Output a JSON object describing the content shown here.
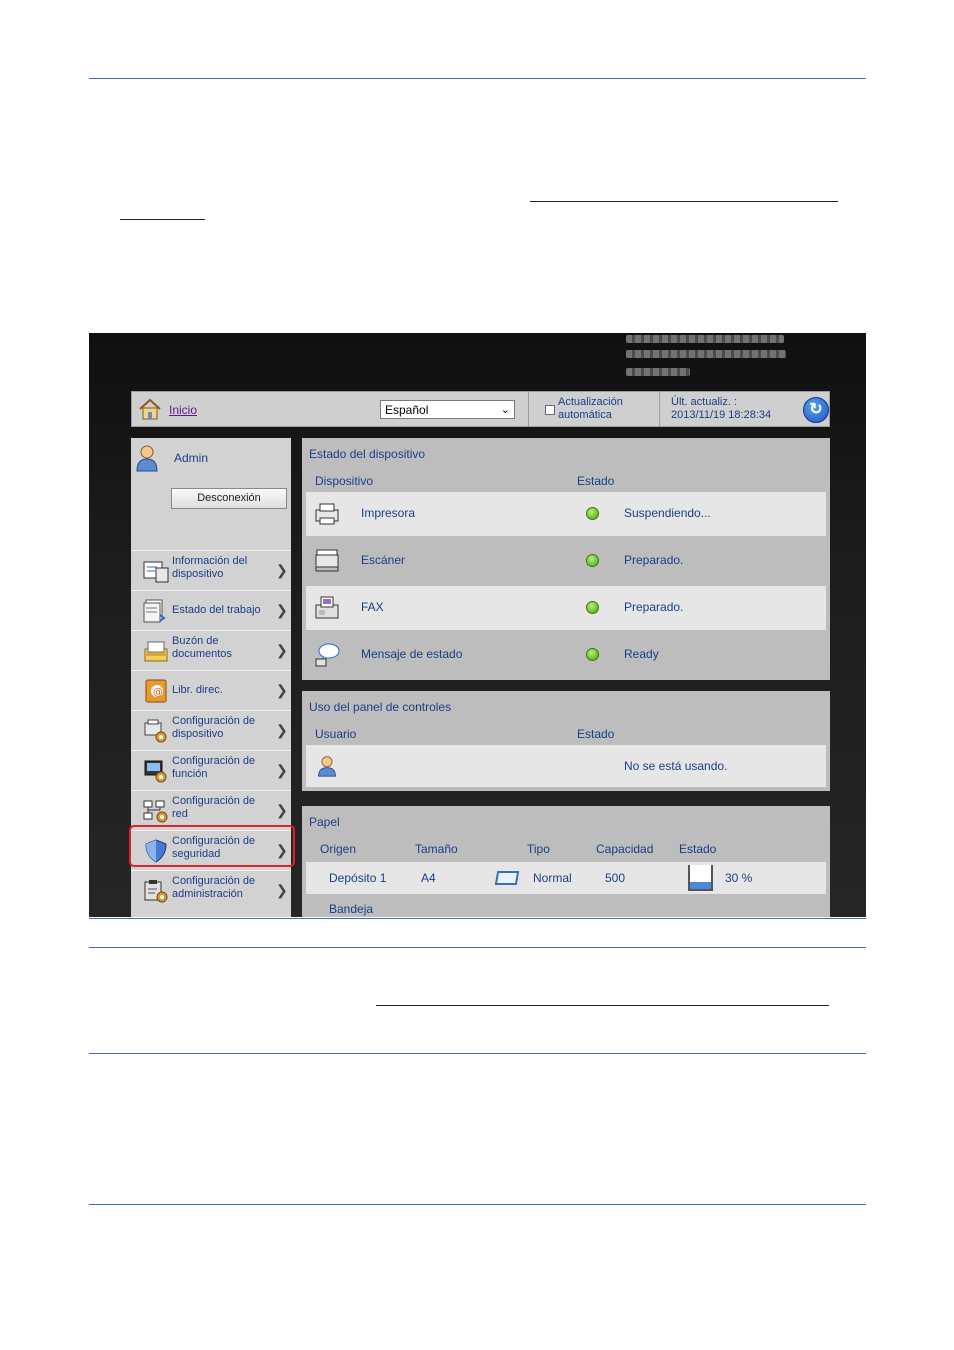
{
  "header": {
    "home_label": "Inicio",
    "language_selected": "Español",
    "auto_update_label_line1": "Actualización",
    "auto_update_label_line2": "automática",
    "last_update_label": "Últ. actualiz. :",
    "last_update_time": "2013/11/19 18:28:34"
  },
  "user": {
    "name": "Admin",
    "logout_label": "Desconexión"
  },
  "sidebar": {
    "items": [
      {
        "line1": "Información del",
        "line2": "dispositivo",
        "icon": "device-info-icon"
      },
      {
        "line1": "Estado del trabajo",
        "line2": "",
        "icon": "job-status-icon"
      },
      {
        "line1": "Buzón de",
        "line2": "documentos",
        "icon": "document-box-icon"
      },
      {
        "line1": "Libr. direc.",
        "line2": "",
        "icon": "address-book-icon"
      },
      {
        "line1": "Configuración de",
        "line2": "dispositivo",
        "icon": "device-settings-icon"
      },
      {
        "line1": "Configuración de",
        "line2": "función",
        "icon": "function-settings-icon"
      },
      {
        "line1": "Configuración de",
        "line2": "red",
        "icon": "network-settings-icon"
      },
      {
        "line1": "Configuración de",
        "line2": "seguridad",
        "icon": "security-shield-icon"
      },
      {
        "line1": "Configuración de",
        "line2": "administración",
        "icon": "management-settings-icon"
      }
    ]
  },
  "device_status": {
    "title": "Estado del dispositivo",
    "col_device": "Dispositivo",
    "col_status": "Estado",
    "rows": [
      {
        "name": "Impresora",
        "status": "Suspendiendo...",
        "icon": "printer-icon"
      },
      {
        "name": "Escáner",
        "status": "Preparado.",
        "icon": "scanner-icon"
      },
      {
        "name": "FAX",
        "status": "Preparado.",
        "icon": "fax-icon"
      },
      {
        "name": "Mensaje de estado",
        "status": "Ready",
        "icon": "status-message-icon"
      }
    ]
  },
  "control_panel": {
    "title": "Uso del panel de controles",
    "col_user": "Usuario",
    "col_status": "Estado",
    "status": "No se está usando."
  },
  "paper": {
    "title": "Papel",
    "col_origin": "Origen",
    "col_size": "Tamaño",
    "col_type": "Tipo",
    "col_capacity": "Capacidad",
    "col_status": "Estado",
    "rows": [
      {
        "origin": "Depósito 1",
        "size": "A4",
        "type": "Normal",
        "capacity": "500",
        "level_text": "30 %",
        "level": 0.3
      }
    ],
    "partial_row": {
      "origin": "Bandeja"
    }
  },
  "colors": {
    "accent": "#1a3e8a",
    "highlight": "#e0202a",
    "rule": "#3b6fb6"
  }
}
